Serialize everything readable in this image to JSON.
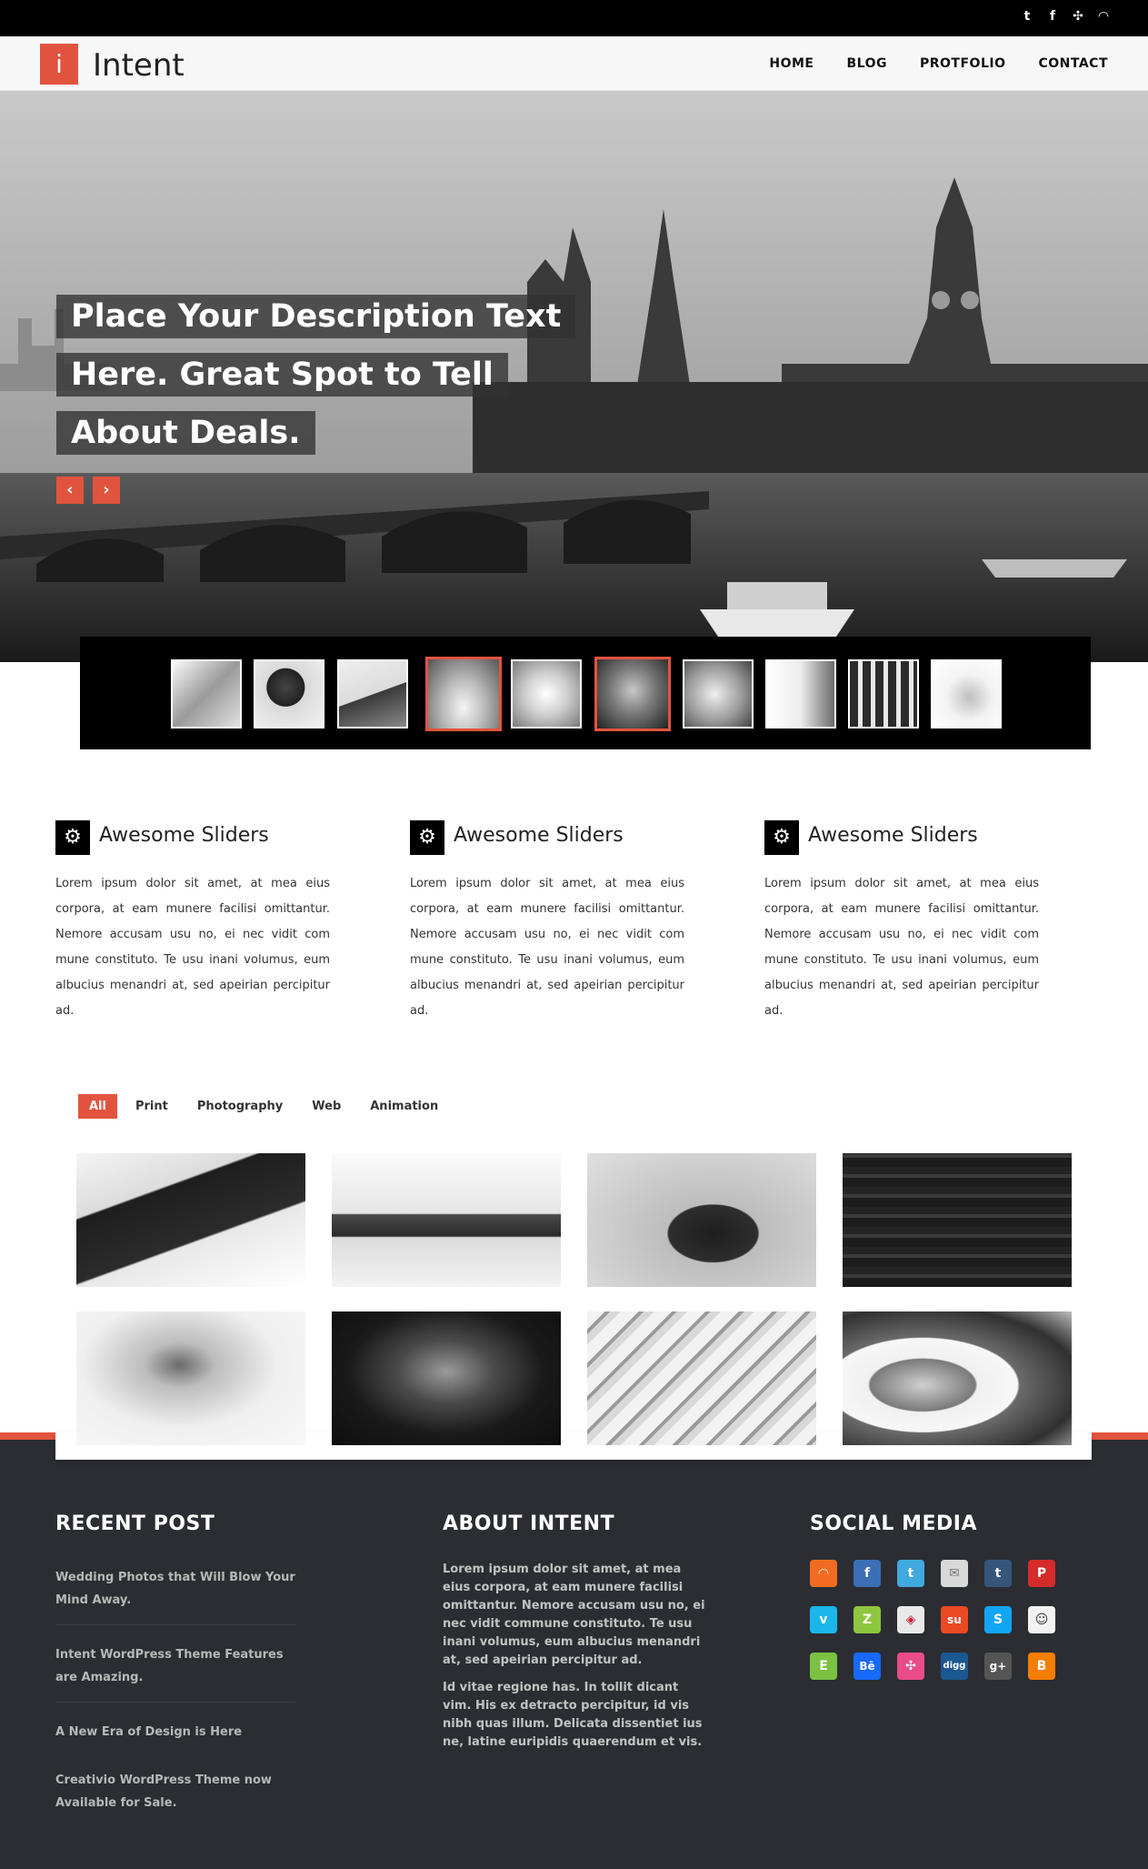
{
  "topbar": {
    "social_icons": [
      "twitter-icon",
      "facebook-icon",
      "dribbble-icon",
      "rss-icon"
    ],
    "social_glyphs": [
      "t",
      "f",
      "✣",
      "◠"
    ]
  },
  "header": {
    "logo_letter": "i",
    "logo_text": "Intent",
    "nav": [
      {
        "label": "HOME"
      },
      {
        "label": "BLOG"
      },
      {
        "label": "PROTFOLIO"
      },
      {
        "label": "CONTACT"
      }
    ]
  },
  "hero": {
    "caption_lines": [
      "Place Your Description Text",
      "Here. Great Spot to Tell",
      "About Deals."
    ],
    "prev_glyph": "‹",
    "next_glyph": "›"
  },
  "thumbnails": {
    "count": 10,
    "active_indexes": [
      3,
      5
    ]
  },
  "features": [
    {
      "icon": "gear-icon",
      "title": "Awesome Sliders",
      "text": "Lorem ipsum dolor sit amet, at mea eius corpora, at eam munere facilisi omittantur. Nemore accusam usu no, ei nec vidit com mune constituto. Te usu inani volumus, eum albucius menandri at, sed apeirian percipitur ad."
    },
    {
      "icon": "gear-icon",
      "title": "Awesome Sliders",
      "text": "Lorem ipsum dolor sit amet, at mea eius corpora, at eam munere facilisi omittantur. Nemore accusam usu no, ei nec vidit com mune constituto. Te usu inani volumus, eum albucius menandri at, sed apeirian percipitur ad."
    },
    {
      "icon": "gear-icon",
      "title": "Awesome Sliders",
      "text": "Lorem ipsum dolor sit amet, at mea eius corpora, at eam munere facilisi omittantur. Nemore accusam usu no, ei nec vidit com mune constituto. Te usu inani volumus, eum albucius menandri at, sed apeirian percipitur ad."
    }
  ],
  "portfolio": {
    "filters": [
      {
        "label": "All",
        "active": true
      },
      {
        "label": "Print",
        "active": false
      },
      {
        "label": "Photography",
        "active": false
      },
      {
        "label": "Web",
        "active": false
      },
      {
        "label": "Animation",
        "active": false
      }
    ],
    "items": [
      {
        "name": "portfolio-business-cards"
      },
      {
        "name": "portfolio-desk"
      },
      {
        "name": "portfolio-couple-hug"
      },
      {
        "name": "portfolio-typography"
      },
      {
        "name": "portfolio-ring"
      },
      {
        "name": "portfolio-portrait-man"
      },
      {
        "name": "portfolio-keyboard"
      },
      {
        "name": "portfolio-wedding-couple"
      }
    ]
  },
  "footer": {
    "recent_post": {
      "title": "RECENT POST",
      "items": [
        "Wedding Photos that Will Blow Your Mind Away.",
        "Intent WordPress Theme Features are Amazing.",
        "A New Era of Design is Here",
        "Creativio WordPress Theme now Available for Sale."
      ]
    },
    "about": {
      "title": "ABOUT INTENT",
      "paragraphs": [
        "Lorem ipsum dolor sit amet, at mea eius corpora, at eam munere facilisi omittantur. Nemore accusam usu no, ei nec vidit commune constituto. Te usu inani volumus, eum albucius menandri at, sed apeirian percipitur ad.",
        "Id vitae regione has. In tollit dicant vim. His ex detracto percipitur, id vis nibh quas illum. Delicata dissentiet ius ne, latine euripidis quaerendum et vis."
      ]
    },
    "social_media": {
      "title": "SOCIAL MEDIA",
      "icons": [
        {
          "name": "rss-icon",
          "glyph": "◠",
          "color": "#f26b21"
        },
        {
          "name": "facebook-icon",
          "glyph": "f",
          "color": "#3b6fb6"
        },
        {
          "name": "twitter-icon",
          "glyph": "t",
          "color": "#3fa9e0"
        },
        {
          "name": "email-icon",
          "glyph": "✉",
          "color": "#d9d9d9"
        },
        {
          "name": "tumblr-icon",
          "glyph": "t",
          "color": "#35567a"
        },
        {
          "name": "pinterest-icon",
          "glyph": "P",
          "color": "#d52b2b"
        },
        {
          "name": "vimeo-icon",
          "glyph": "v",
          "color": "#1ab7ea"
        },
        {
          "name": "zerply-icon",
          "glyph": "Z",
          "color": "#8dc63f"
        },
        {
          "name": "picasa-icon",
          "glyph": "◈",
          "color": "#e9e9e9"
        },
        {
          "name": "stumbleupon-icon",
          "glyph": "su",
          "color": "#eb4924"
        },
        {
          "name": "skype-icon",
          "glyph": "S",
          "color": "#12a5f4"
        },
        {
          "name": "reddit-icon",
          "glyph": "☺",
          "color": "#f2f2f2"
        },
        {
          "name": "evernote-icon",
          "glyph": "E",
          "color": "#7ac142"
        },
        {
          "name": "behance-icon",
          "glyph": "Bē",
          "color": "#1769ff"
        },
        {
          "name": "dribbble-icon",
          "glyph": "✣",
          "color": "#ea4c89"
        },
        {
          "name": "digg-icon",
          "glyph": "digg",
          "color": "#1b5891"
        },
        {
          "name": "googleplus-icon",
          "glyph": "g+",
          "color": "#555555"
        },
        {
          "name": "blogger-icon",
          "glyph": "B",
          "color": "#f57d00"
        }
      ]
    }
  }
}
